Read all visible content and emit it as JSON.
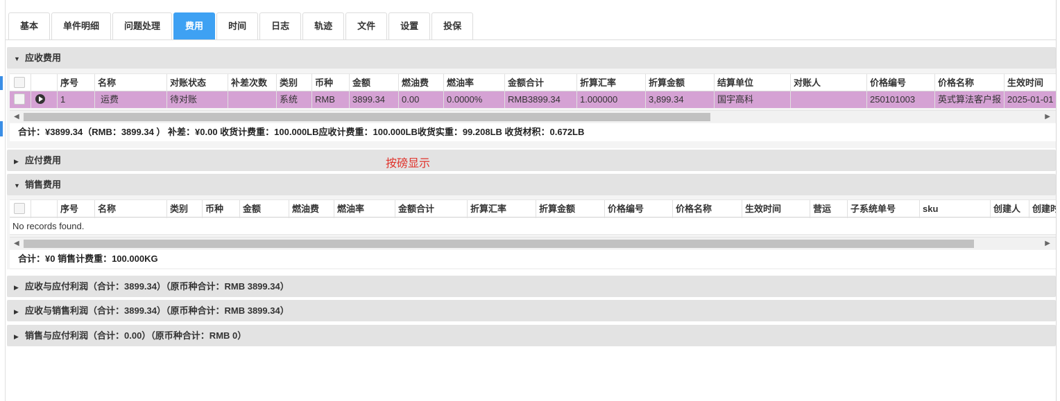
{
  "tabs": [
    "基本",
    "单件明细",
    "问题处理",
    "费用",
    "时间",
    "日志",
    "轨迹",
    "文件",
    "设置",
    "投保"
  ],
  "active_tab": "费用",
  "receivable": {
    "title": "应收费用",
    "columns": [
      "序号",
      "名称",
      "对账状态",
      "补差次数",
      "类别",
      "币种",
      "金额",
      "燃油费",
      "燃油率",
      "金额合计",
      "折算汇率",
      "折算金额",
      "结算单位",
      "对账人",
      "价格编号",
      "价格名称",
      "生效时间"
    ],
    "row": [
      "1",
      "运费",
      "待对账",
      "",
      "系统",
      "RMB",
      "3899.34",
      "0.00",
      "0.0000%",
      "RMB3899.34",
      "1.000000",
      "3,899.34",
      "国宇高科",
      "",
      "250101003",
      "英式算法客户报",
      "2025-01-01"
    ],
    "summary": "合计：¥3899.34（RMB：3899.34 ）   补差：¥0.00    收货计费重：100.000LB应收计费重：100.000LB收货实重：99.208LB 收货材积：0.672LB"
  },
  "payable": {
    "title": "应付费用"
  },
  "note": "按磅显示",
  "sales": {
    "title": "销售费用",
    "columns": [
      "序号",
      "名称",
      "类别",
      "币种",
      "金额",
      "燃油费",
      "燃油率",
      "金额合计",
      "折算汇率",
      "折算金额",
      "价格编号",
      "价格名称",
      "生效时间",
      "营运",
      "子系统单号",
      "sku",
      "创建人",
      "创建时"
    ],
    "empty": "No records found.",
    "summary": "合计：¥0    销售计费重：100.000KG"
  },
  "profits": [
    "应收与应付利润（合计：3899.34）（原币种合计：RMB 3899.34）",
    "应收与销售利润（合计：3899.34）（原币种合计：RMB 3899.34）",
    "销售与应付利润（合计：0.00）（原币种合计：RMB 0）"
  ],
  "colors": {
    "active_tab": "#3ea1f3",
    "selected_row": "#d5a2d4",
    "note": "#e0322a"
  }
}
